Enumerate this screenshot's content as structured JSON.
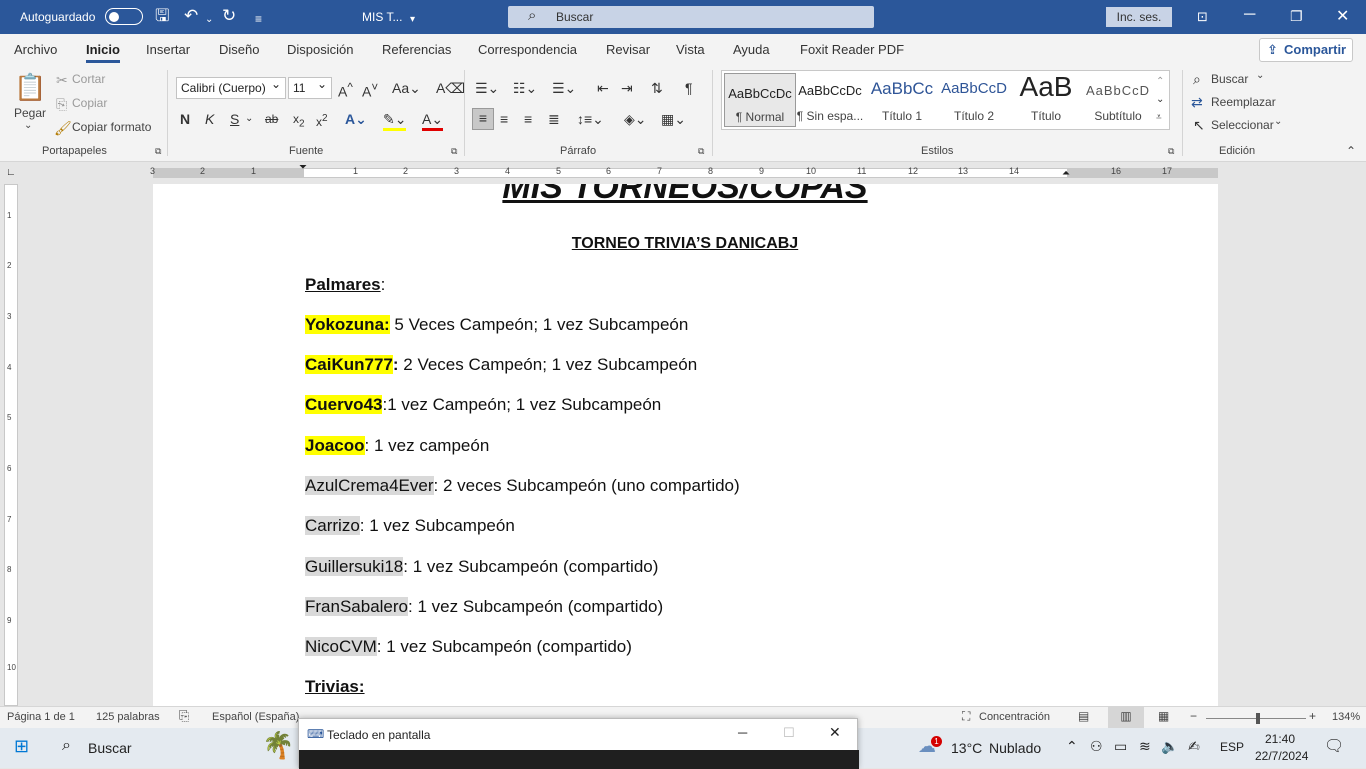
{
  "titlebar": {
    "autosave_label": "Autoguardado",
    "doc_title": "MIS T...",
    "search_placeholder": "Buscar",
    "signin_label": "Inc. ses."
  },
  "menu": {
    "tabs": [
      "Archivo",
      "Inicio",
      "Insertar",
      "Diseño",
      "Disposición",
      "Referencias",
      "Correspondencia",
      "Revisar",
      "Vista",
      "Ayuda",
      "Foxit Reader PDF"
    ],
    "active_tab": "Inicio",
    "share_label": "Compartir"
  },
  "ribbon": {
    "clipboard": {
      "paste_label": "Pegar",
      "cut_label": "Cortar",
      "copy_label": "Copiar",
      "format_painter_label": "Copiar formato",
      "group_label": "Portapapeles"
    },
    "font": {
      "font_name": "Calibri (Cuerpo)",
      "font_size": "11",
      "group_label": "Fuente"
    },
    "paragraph": {
      "group_label": "Párrafo"
    },
    "styles": {
      "items": [
        {
          "preview": "AaBbCcDc",
          "name": "¶ Normal"
        },
        {
          "preview": "AaBbCcDc",
          "name": "¶ Sin espa..."
        },
        {
          "preview": "AaBbCc",
          "name": "Título 1"
        },
        {
          "preview": "AaBbCcD",
          "name": "Título 2"
        },
        {
          "preview": "AaB",
          "name": "Título"
        },
        {
          "preview": "AaBbCcD",
          "name": "Subtítulo"
        }
      ],
      "group_label": "Estilos"
    },
    "editing": {
      "find_label": "Buscar",
      "replace_label": "Reemplazar",
      "select_label": "Seleccionar",
      "group_label": "Edición"
    }
  },
  "ruler": {
    "numbers": [
      "3",
      "2",
      "1",
      "1",
      "2",
      "3",
      "4",
      "5",
      "6",
      "7",
      "8",
      "9",
      "10",
      "11",
      "12",
      "13",
      "14",
      "16",
      "17"
    ]
  },
  "vruler": {
    "numbers": [
      "1",
      "2",
      "3",
      "4",
      "5",
      "6",
      "7",
      "8",
      "9",
      "10"
    ]
  },
  "document": {
    "title": "MIS TORNEOS/COPAS",
    "subtitle": "TORNEO TRIVIA’S DANICABJ",
    "palmares_label": "Palmares",
    "palmares_colon": ":",
    "entries": [
      {
        "name": "Yokozuna:",
        "text": " 5 Veces Campeón; 1 vez Subcampeón",
        "style": "yellow"
      },
      {
        "name": "CaiKun777",
        "suffix": ":",
        "text": " 2 Veces Campeón; 1 vez Subcampeón",
        "style": "yellow"
      },
      {
        "name": "Cuervo43",
        "text": ":1 vez Campeón; 1 vez Subcampeón",
        "style": "yellow"
      },
      {
        "name": "Joacoo",
        "text": ": 1 vez campeón",
        "style": "yellow"
      },
      {
        "name": "AzulCrema4Ever",
        "text": ": 2 veces Subcampeón (uno compartido)",
        "style": "gray"
      },
      {
        "name": "Carrizo",
        "text": ": 1 vez Subcampeón",
        "style": "gray"
      },
      {
        "name": "Guillersuki18",
        "text": ": 1 vez Subcampeón (compartido)",
        "style": "gray"
      },
      {
        "name": "FranSabalero",
        "text": ": 1 vez Subcampeón (compartido)",
        "style": "gray"
      },
      {
        "name": "NicoCVM",
        "text": ": 1 vez Subcampeón (compartido)",
        "style": "gray"
      }
    ],
    "trivias_label": "Trivias:"
  },
  "statusbar": {
    "page": "Página 1 de 1",
    "words": "125 palabras",
    "language": "Español (España)",
    "focus_label": "Concentración",
    "zoom": "134%"
  },
  "osk": {
    "title": "Teclado en pantalla"
  },
  "taskbar": {
    "search_label": "Buscar",
    "weather_temp": "13°C",
    "weather_text": "Nublado",
    "weather_badge": "1",
    "lang": "ESP",
    "time": "21:40",
    "date": "22/7/2024"
  },
  "colors": {
    "accent": "#2b579a",
    "highlight_yellow": "#ffff00",
    "highlight_gray": "#d9d9d9"
  }
}
